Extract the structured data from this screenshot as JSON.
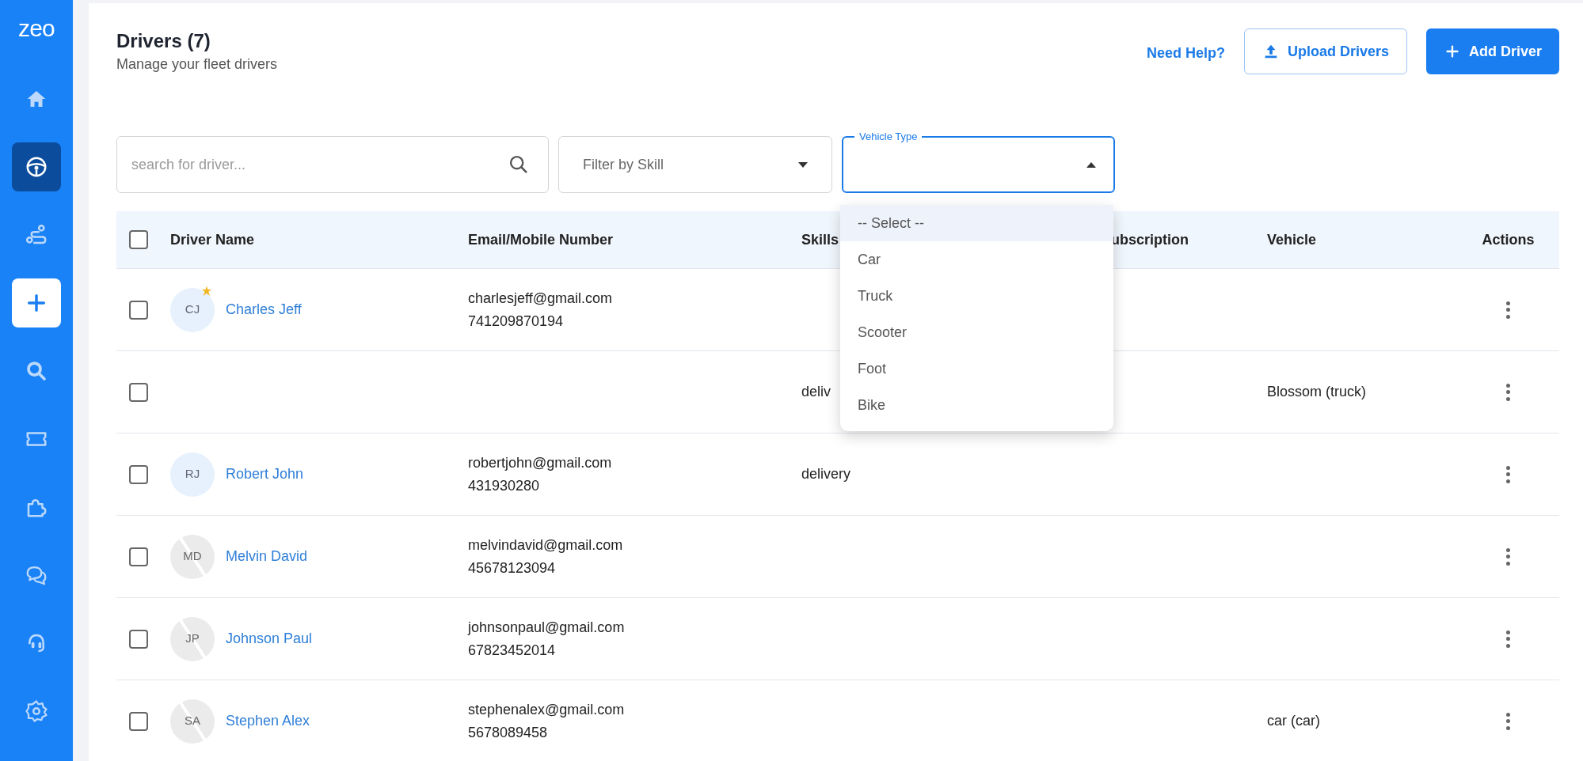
{
  "sidebar": {
    "logo": "zeo",
    "items": [
      {
        "kind": "nav",
        "selected": false
      },
      {
        "kind": "nav",
        "selected": true
      },
      {
        "kind": "nav",
        "selected": false
      },
      {
        "kind": "action",
        "selected": false
      },
      {
        "kind": "nav",
        "selected": false
      },
      {
        "kind": "nav",
        "selected": false
      },
      {
        "kind": "nav",
        "selected": false
      },
      {
        "kind": "nav",
        "selected": false
      },
      {
        "kind": "nav",
        "selected": false
      },
      {
        "kind": "nav",
        "selected": false
      }
    ]
  },
  "header": {
    "title": "Drivers (7)",
    "subtitle": "Manage your fleet drivers",
    "help_link": "Need Help?",
    "upload_button": "Upload Drivers",
    "add_button": "Add Driver"
  },
  "filters": {
    "search": {
      "placeholder": "search for driver..."
    },
    "skill": {
      "placeholder": "Filter by Skill"
    },
    "vehicle_type": {
      "label": "Vehicle Type",
      "expanded": true,
      "options": [
        {
          "label": "-- Select --",
          "highlighted": true
        },
        {
          "label": "Car",
          "highlighted": false
        },
        {
          "label": "Truck",
          "highlighted": false
        },
        {
          "label": "Scooter",
          "highlighted": false
        },
        {
          "label": "Foot",
          "highlighted": false
        },
        {
          "label": "Bike",
          "highlighted": false
        }
      ]
    }
  },
  "table": {
    "select_all": {
      "checked": false
    },
    "columns": [
      "Driver Name",
      "Email/Mobile Number",
      "Skills",
      "ubscription",
      "Vehicle",
      "Actions"
    ],
    "rows": [
      {
        "checked": false,
        "avatar": {
          "kind": "initials",
          "initials": "CJ",
          "badge": true
        },
        "name": "Charles Jeff",
        "email": "charlesjeff@gmail.com",
        "phone": "741209870194"
      },
      {
        "checked": false,
        "skills": "deliv",
        "vehicle": "Blossom (truck)"
      },
      {
        "checked": false,
        "avatar": {
          "kind": "initials",
          "initials": "RJ",
          "badge": false
        },
        "name": "Robert John",
        "email": "robertjohn@gmail.com",
        "phone": "431930280",
        "skills": "delivery"
      },
      {
        "checked": false,
        "avatar": {
          "kind": "broken",
          "initials": "MD",
          "badge": false
        },
        "name": "Melvin David",
        "email": "melvindavid@gmail.com",
        "phone": "45678123094"
      },
      {
        "checked": false,
        "avatar": {
          "kind": "broken",
          "initials": "JP",
          "badge": false
        },
        "name": "Johnson Paul",
        "email": "johnsonpaul@gmail.com",
        "phone": "67823452014"
      },
      {
        "checked": false,
        "avatar": {
          "kind": "broken",
          "initials": "SA",
          "badge": false
        },
        "name": "Stephen Alex",
        "email": "stephenalex@gmail.com",
        "phone": "5678089458",
        "vehicle": "car (car)"
      }
    ]
  }
}
